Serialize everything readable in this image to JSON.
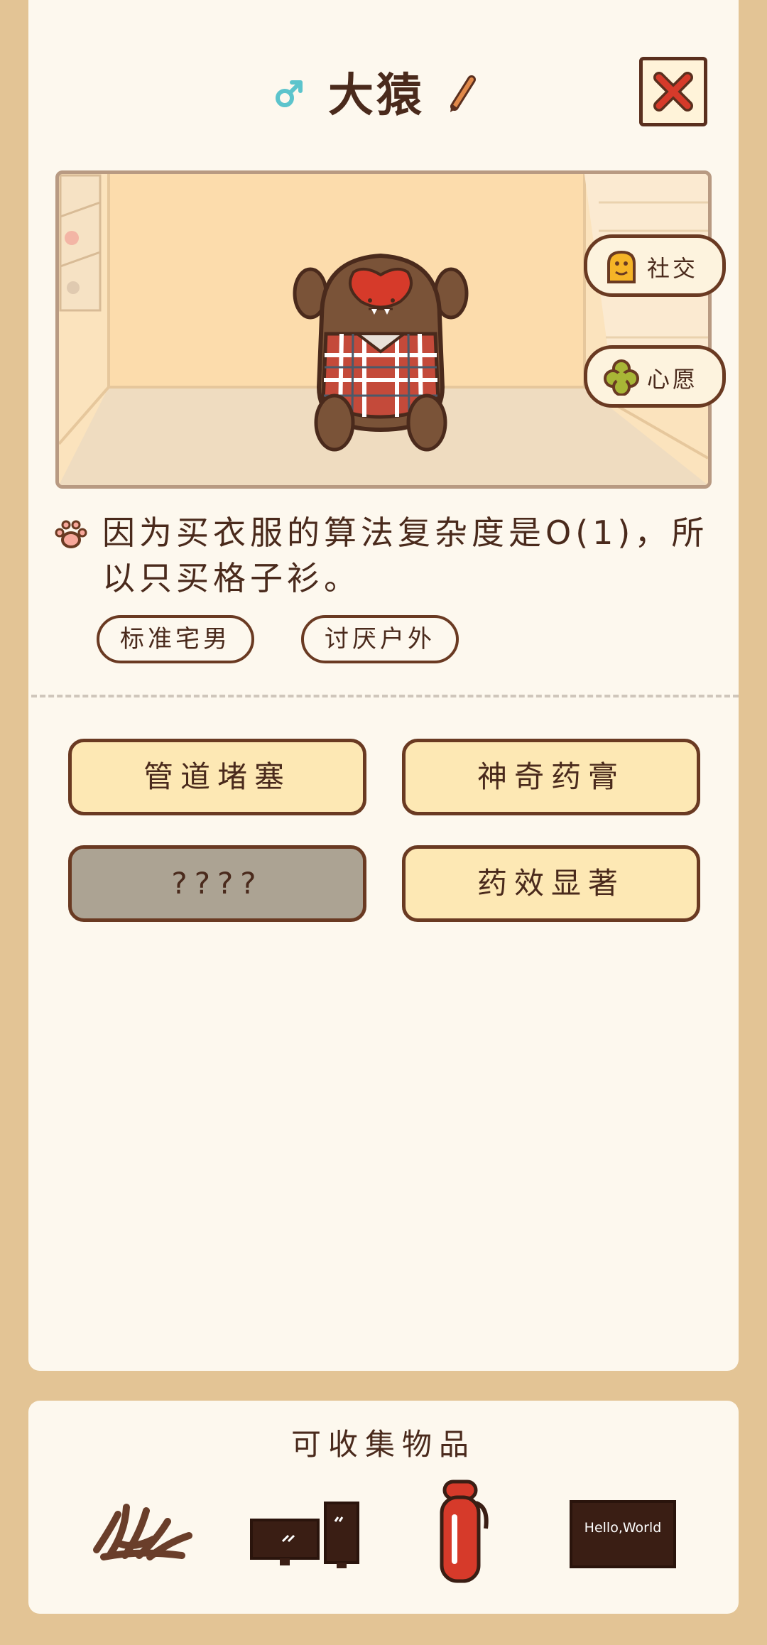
{
  "character": {
    "name": "大猿",
    "gender_symbol": "♂",
    "description": "因为买衣服的算法复杂度是O(1)，所以只买格子衫。",
    "tags": [
      "标准宅男",
      "讨厌户外"
    ]
  },
  "scene_buttons": {
    "social": "社交",
    "wish": "心愿"
  },
  "skills": [
    {
      "label": "管道堵塞",
      "locked": false
    },
    {
      "label": "神奇药膏",
      "locked": false
    },
    {
      "label": "????",
      "locked": true
    },
    {
      "label": "药效显著",
      "locked": false
    }
  ],
  "collectibles": {
    "title": "可收集物品",
    "items": [
      {
        "icon": "hair-tuft-icon"
      },
      {
        "icon": "dual-monitor-icon"
      },
      {
        "icon": "thermos-icon"
      },
      {
        "icon": "chalkboard-icon",
        "text": "Hello,World"
      }
    ]
  },
  "colors": {
    "background": "#e3c495",
    "card": "#fdf8ee",
    "skill_button": "#fde8b4",
    "locked_button": "#aca393",
    "outline": "#6a3a22",
    "accent_red": "#d63a2a"
  }
}
